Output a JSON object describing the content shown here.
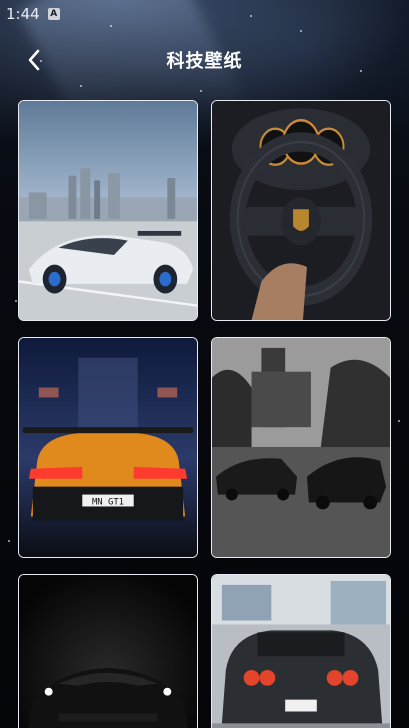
{
  "status_bar": {
    "time": "1:44",
    "badge": "A"
  },
  "nav": {
    "title": "科技壁纸",
    "back_icon": "chevron-left-icon"
  },
  "wallpapers": [
    {
      "id": "white-lamborghini-city",
      "license_plate": ""
    },
    {
      "id": "porsche-steering-wheel",
      "license_plate": ""
    },
    {
      "id": "orange-huracan-rear",
      "license_plate": "MN GT1"
    },
    {
      "id": "bw-cars-street",
      "license_plate": ""
    },
    {
      "id": "dark-lamborghini-front",
      "license_plate": ""
    },
    {
      "id": "skyline-rear-garage",
      "license_plate": ""
    }
  ],
  "colors": {
    "accent": "#ffffff",
    "card_border": "#e8ecf2",
    "background": "#05070c"
  }
}
